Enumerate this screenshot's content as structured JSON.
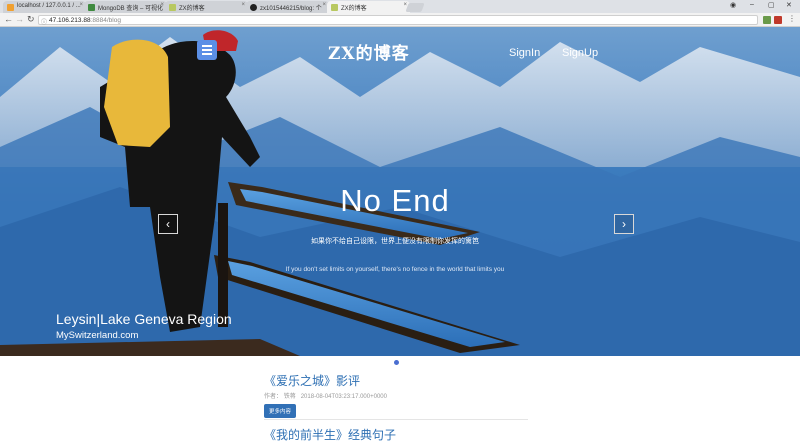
{
  "browser": {
    "tabs": [
      {
        "title": "localhost / 127.0.0.1 / ...",
        "favicon_color": "#f0a030"
      },
      {
        "title": "MongoDB 查询 – 可视化",
        "favicon_color": "#3f8a3f"
      },
      {
        "title": "ZX的博客",
        "favicon_color": "#b8c860"
      },
      {
        "title": "zx1015446215/blog: 个",
        "favicon_color": "#222222"
      },
      {
        "title": "ZX的博客",
        "favicon_color": "#b8c860"
      }
    ],
    "address": {
      "host": "47.106.213.88",
      "rest": ":8884/blog"
    }
  },
  "header": {
    "logo": "ZX的博客",
    "signin": "SignIn",
    "signup": "SignUp"
  },
  "hero": {
    "title": "No  End",
    "subtitle_cn": "如果你不给自己设限，世界上便没有限制你发挥的篱笆",
    "subtitle_en": "If you don't set limits on yourself, there's no fence in the world that limits you",
    "caption": "Leysin|Lake Geneva Region",
    "credit": "MySwitzerland.com",
    "prev_glyph": "‹",
    "next_glyph": "›",
    "colors": {
      "sky": "#4d87c4",
      "deep": "#2a6db4",
      "accent": "#5b8fe6"
    }
  },
  "posts": [
    {
      "title": "《爱乐之城》影评",
      "author_label": "作者：",
      "author": "铁蒋",
      "date": "2018-08-04T03:23:17.000+0000",
      "more": "更多内容"
    },
    {
      "title": "《我的前半生》经典句子"
    }
  ]
}
